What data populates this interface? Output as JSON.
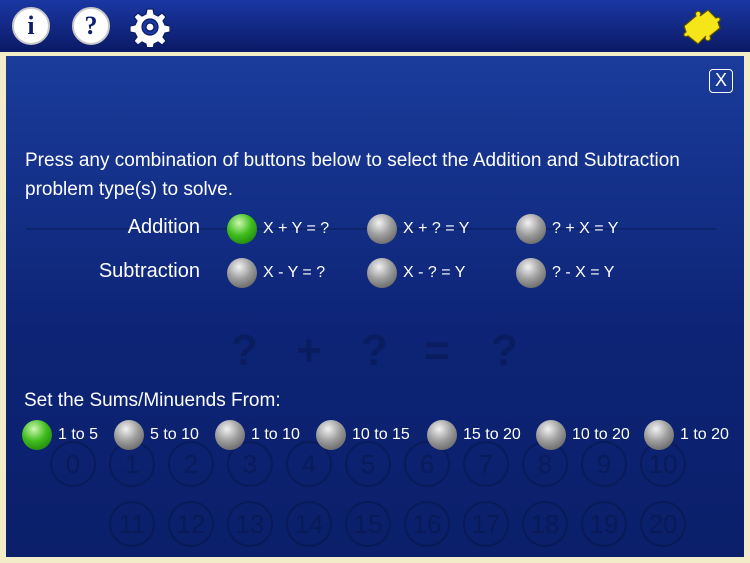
{
  "toolbar": {
    "info_label": "i",
    "help_label": "?"
  },
  "dialog": {
    "close_label": "X",
    "instructions": "Press any combination of buttons below to select the Addition and Subtraction problem type(s) to solve.",
    "addition_label": "Addition",
    "subtraction_label": "Subtraction",
    "addition_options": [
      {
        "label": "X + Y = ?",
        "selected": true
      },
      {
        "label": "X + ? = Y",
        "selected": false
      },
      {
        "label": "? + X = Y",
        "selected": false
      }
    ],
    "subtraction_options": [
      {
        "label": "X - Y = ?",
        "selected": false
      },
      {
        "label": "X - ? = Y",
        "selected": false
      },
      {
        "label": "? - X = Y",
        "selected": false
      }
    ],
    "sums_label": "Set the Sums/Minuends From:",
    "range_options": [
      {
        "label": "1 to 5",
        "selected": true
      },
      {
        "label": "5 to 10",
        "selected": false
      },
      {
        "label": "1 to 10",
        "selected": false
      },
      {
        "label": "10 to 15",
        "selected": false
      },
      {
        "label": "15 to 20",
        "selected": false
      },
      {
        "label": "10 to 20",
        "selected": false
      },
      {
        "label": "1 to 20",
        "selected": false
      }
    ]
  },
  "background": {
    "equation": [
      "?",
      "+",
      "?",
      "=",
      "?"
    ],
    "row1": [
      "0",
      "1",
      "2",
      "3",
      "4",
      "5",
      "6",
      "7",
      "8",
      "9",
      "10"
    ],
    "row2": [
      "11",
      "12",
      "13",
      "14",
      "15",
      "16",
      "17",
      "18",
      "19",
      "20"
    ]
  },
  "colors": {
    "selected": "#3fbd1d",
    "unselected": "#9c9c9c",
    "panel_border": "#f3ecc8",
    "background": "#0d1e6e"
  },
  "icons": [
    "info-icon",
    "help-icon",
    "gear-icon",
    "puzzle-icon",
    "close-icon"
  ]
}
